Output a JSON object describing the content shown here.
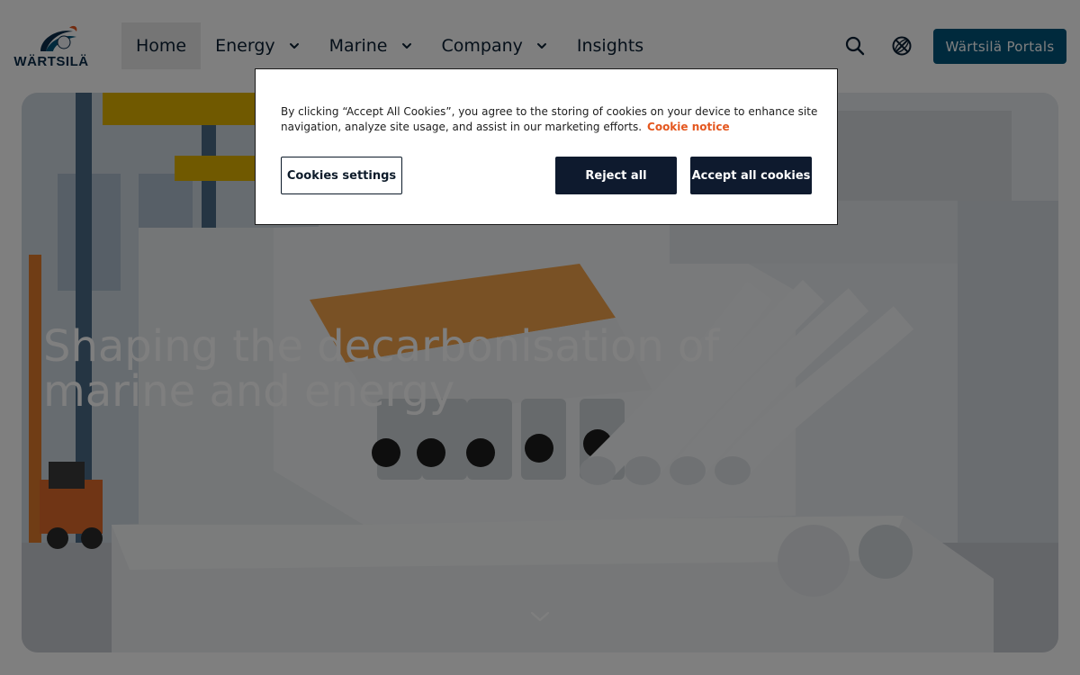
{
  "brand": {
    "logo_text": "WÄRTSILÄ",
    "colors": {
      "primary": "#00547a",
      "dark": "#0a2c4a",
      "accent": "#e4571f"
    }
  },
  "nav": {
    "items": [
      {
        "label": "Home",
        "has_dropdown": false,
        "active": true
      },
      {
        "label": "Energy",
        "has_dropdown": true
      },
      {
        "label": "Marine",
        "has_dropdown": true
      },
      {
        "label": "Company",
        "has_dropdown": true
      },
      {
        "label": "Insights",
        "has_dropdown": false
      }
    ]
  },
  "header": {
    "icons": [
      "search-icon",
      "globe-icon"
    ],
    "portals_label": "Wärtsilä Portals"
  },
  "hero": {
    "title": "Shaping the decarbonisation of marine and energy",
    "scroll_icon": "chevron-down-icon"
  },
  "cookie_banner": {
    "text": "By clicking “Accept All Cookies”, you agree to the storing of cookies on your device to enhance site navigation, analyze site usage, and assist in our marketing efforts.",
    "link_label": "Cookie notice",
    "settings_label": "Cookies settings",
    "reject_label": "Reject all",
    "accept_label": "Accept all cookies"
  }
}
